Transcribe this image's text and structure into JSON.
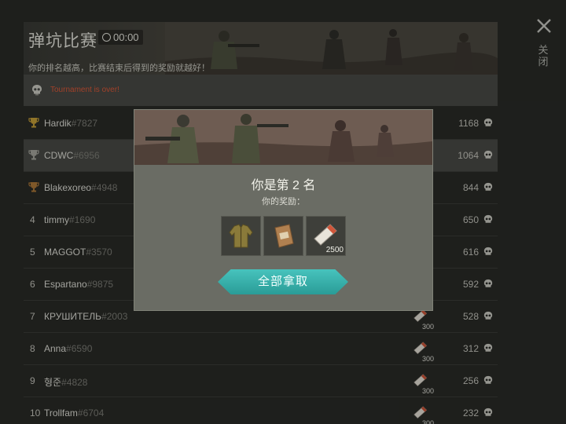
{
  "tournament": {
    "title": "弹坑比赛",
    "timer": "00:00",
    "subtitle": "你的排名越高，比赛结束后得到的奖励就越好！",
    "notice": "Tournament is over!"
  },
  "close_label": "关闭",
  "players": [
    {
      "rank": "1",
      "name": "Hardik",
      "tag": "#7827",
      "score": "1168",
      "trophy": "gold",
      "reward_qty": ""
    },
    {
      "rank": "2",
      "name": "CDWC",
      "tag": "#6956",
      "score": "1064",
      "trophy": "silver",
      "reward_qty": ""
    },
    {
      "rank": "3",
      "name": "Blakexoreo",
      "tag": "#4948",
      "score": "844",
      "trophy": "bronze",
      "reward_qty": ""
    },
    {
      "rank": "4",
      "name": "timmy",
      "tag": "#1690",
      "score": "650",
      "trophy": "",
      "reward_qty": ""
    },
    {
      "rank": "5",
      "name": "MAGGOT",
      "tag": "#3570",
      "score": "616",
      "trophy": "",
      "reward_qty": ""
    },
    {
      "rank": "6",
      "name": "Espartano",
      "tag": "#9875",
      "score": "592",
      "trophy": "",
      "reward_qty": ""
    },
    {
      "rank": "7",
      "name": "КРУШИТЕЛЬ",
      "tag": "#2003",
      "score": "528",
      "trophy": "",
      "reward_qty": "300"
    },
    {
      "rank": "8",
      "name": "Anna",
      "tag": "#6590",
      "score": "312",
      "trophy": "",
      "reward_qty": "300"
    },
    {
      "rank": "9",
      "name": "형준",
      "tag": "#4828",
      "score": "256",
      "trophy": "",
      "reward_qty": "300"
    },
    {
      "rank": "10",
      "name": "Trollfam",
      "tag": "#6704",
      "score": "232",
      "trophy": "",
      "reward_qty": "300"
    }
  ],
  "modal": {
    "place_text": "你是第 2 名",
    "rewards_label": "你的奖励：",
    "rewards": [
      {
        "icon": "jacket-icon",
        "qty": ""
      },
      {
        "icon": "supply-bag-icon",
        "qty": ""
      },
      {
        "icon": "ticket-icon",
        "qty": "2500"
      }
    ],
    "claim_label": "全部拿取"
  },
  "colors": {
    "accent": "#35b0aa",
    "notice": "#e05a3a",
    "gold": "#c9a23a",
    "silver": "#a8a8a0",
    "bronze": "#b07a3a"
  }
}
